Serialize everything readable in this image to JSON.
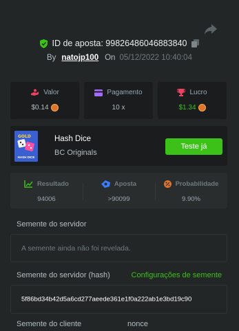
{
  "header": {
    "bet_id_label": "ID de aposta: 99826486046883840",
    "by_label": "By",
    "username": "natojp100",
    "on_label": "On",
    "date": "05/12/2022 10:40:04"
  },
  "stats": [
    {
      "label": "Valor",
      "value": "$0.14",
      "icon": "bet-hand-icon",
      "color": "#ed4163"
    },
    {
      "label": "Pagamento",
      "value": "10 x",
      "icon": "card-icon",
      "color": "#a56bff"
    },
    {
      "label": "Lucro",
      "value": "$1.34",
      "icon": "trophy-icon",
      "color": "#ed4163",
      "value_color": "#3bc117"
    }
  ],
  "game": {
    "thumb_text": "HASH DICE",
    "name": "Hash Dice",
    "provider": "BC Originals",
    "play_label": "Teste já"
  },
  "result": [
    {
      "label": "Resultado",
      "value": "94006",
      "icon": "chart-icon",
      "color": "#3bc117"
    },
    {
      "label": "Aposta",
      "value": ">90099",
      "icon": "chip-icon",
      "color": "#3b7bff"
    },
    {
      "label": "Probabilidade",
      "value": "9.90%",
      "icon": "percent-icon",
      "color": "#e0732e"
    }
  ],
  "seeds": {
    "server_label": "Semente do servidor",
    "server_value": "A semente ainda não foi revelada.",
    "server_hash_label": "Semente do servidor (hash)",
    "settings_link": "Configurações de semente",
    "server_hash_value": "5f86bd34b42d5a6cd277aeede361e1f0a222ab1e3bd19c90",
    "client_label": "Semente do cliente",
    "nonce_label": "nonce"
  },
  "colors": {
    "background": "#232626",
    "panel": "#1a1c1d",
    "accent_green": "#3bc117"
  }
}
